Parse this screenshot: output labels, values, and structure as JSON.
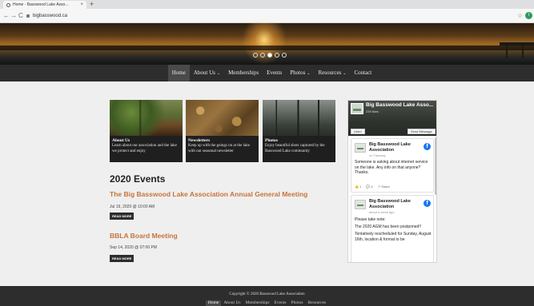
{
  "browser": {
    "tab_title": "Home - Basswood Lake Asso...",
    "tab_close": "×",
    "new_tab": "+",
    "back": "←",
    "forward": "→",
    "reload": "C",
    "url": "bigbasswood.ca",
    "star": "☆",
    "profile_initial": "I"
  },
  "nav": {
    "items": [
      {
        "label": "Home",
        "active": true
      },
      {
        "label": "About Us",
        "caret": "⌄"
      },
      {
        "label": "Memberships"
      },
      {
        "label": "Events"
      },
      {
        "label": "Photos",
        "caret": "⌄"
      },
      {
        "label": "Resources",
        "caret": "⌄"
      },
      {
        "label": "Contact"
      }
    ]
  },
  "slider": {
    "dot_count": 5,
    "active_index": 2
  },
  "cards": [
    {
      "title": "About Us",
      "desc": "Learn about our association and the lake we protect and enjoy"
    },
    {
      "title": "Newsletters",
      "desc": "Keep up with the goings on at the lake with our seasonal newsletter"
    },
    {
      "title": "Photos",
      "desc": "Enjoy beautiful shots captured by the Basswood Lake community"
    }
  ],
  "events": {
    "heading": "2020 Events",
    "read_more": "READ MORE",
    "items": [
      {
        "title": "The Big Basswood Lake Association Annual General Meeting",
        "date": "Jul 19, 2020 @ 10:00 AM"
      },
      {
        "title": "BBLA Board Meeting",
        "date": "Sep 14, 2020 @ 07:00 PM"
      }
    ]
  },
  "facebook": {
    "page_name": "Big Basswood Lake Asso...",
    "likes": "239 likes",
    "like_btn": "Liked",
    "send_btn": "Send Message",
    "fb_glyph": "f",
    "posts": [
      {
        "author": "Big Basswood Lake Association",
        "time": "on Tuesday",
        "text": "Someone is asking about internet service on the lake. Any info on that anyone? Thanks.",
        "likes": "1",
        "comments": "6",
        "share": "Share"
      },
      {
        "author": "Big Basswood Lake Association",
        "time": "about a week ago",
        "lines": [
          "Please take note:",
          "The 2020 AGM has been postponed!!",
          "Tentatively rescheduled for Sunday, August 16th, location & format to be"
        ]
      }
    ]
  },
  "footer": {
    "copyright": "Copyright © 2020 Basswood Lake Association",
    "links": [
      {
        "label": "Home",
        "active": true
      },
      {
        "label": "About Us"
      },
      {
        "label": "Memberships"
      },
      {
        "label": "Events"
      },
      {
        "label": "Photos"
      },
      {
        "label": "Resources"
      }
    ]
  },
  "colors": {
    "accent": "#c8743a",
    "nav_bg": "#2d2d2d",
    "facebook_blue": "#1877f2"
  }
}
